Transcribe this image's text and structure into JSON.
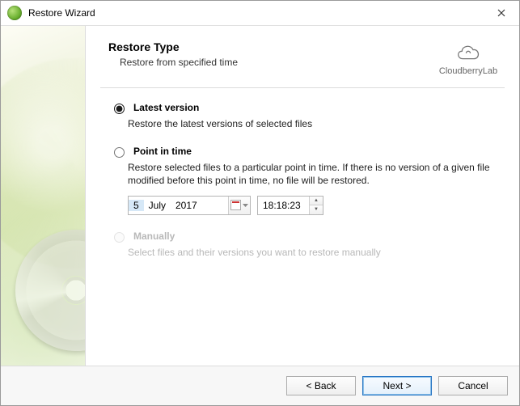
{
  "window": {
    "title": "Restore Wizard"
  },
  "header": {
    "title": "Restore Type",
    "subtitle": "Restore from specified time"
  },
  "brand": {
    "label": "CloudberryLab"
  },
  "options": {
    "latest": {
      "label": "Latest version",
      "desc": "Restore the latest versions of selected files",
      "selected": true
    },
    "point": {
      "label": "Point in time",
      "desc": "Restore selected files to a particular point in time. If there is no version of a given file modified before this point in time, no file will be restored.",
      "date": {
        "day": "5",
        "month": "July",
        "year": "2017"
      },
      "time": "18:18:23"
    },
    "manual": {
      "label": "Manually",
      "desc": "Select files and their versions you want to restore manually",
      "enabled": false
    }
  },
  "footer": {
    "back": "< Back",
    "next": "Next >",
    "cancel": "Cancel"
  }
}
